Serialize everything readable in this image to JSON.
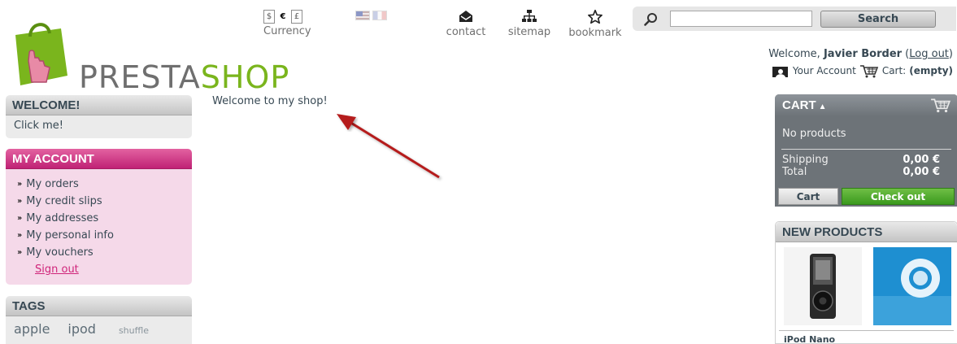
{
  "brand": {
    "logo_left": "PRESTA",
    "logo_right": "SHOP",
    "accent": "#7ab51d",
    "pink": "#c02275"
  },
  "header": {
    "currencies": [
      "$",
      "€",
      "£"
    ],
    "currency_selected": "€",
    "currency_label": "Currency",
    "languages": [
      "flag-us-icon",
      "flag-fr-icon"
    ],
    "permalinks": {
      "contact": "contact",
      "sitemap": "sitemap",
      "bookmark": "bookmark"
    },
    "search": {
      "value": "",
      "button": "Search"
    },
    "user": {
      "welcome": "Welcome,",
      "name": "Javier Border",
      "logout": "Log out",
      "your_account": "Your Account",
      "cart_label": "Cart:",
      "cart_state": "(empty)"
    }
  },
  "left": {
    "welcome": {
      "title": "WELCOME!",
      "body": "Click me!"
    },
    "account": {
      "title": "MY ACCOUNT",
      "items": [
        "My orders",
        "My credit slips",
        "My addresses",
        "My personal info",
        "My vouchers"
      ],
      "signout": "Sign out"
    },
    "tags": {
      "title": "TAGS",
      "items": [
        "apple",
        "ipod",
        "shuffle"
      ]
    }
  },
  "center": {
    "text": "Welcome to my shop!"
  },
  "right": {
    "cart": {
      "title": "CART",
      "empty": "No products",
      "shipping_label": "Shipping",
      "shipping_value": "0,00 €",
      "total_label": "Total",
      "total_value": "0,00 €",
      "cart_button": "Cart",
      "checkout_button": "Check out"
    },
    "new_products": {
      "title": "NEW PRODUCTS",
      "first_name": "iPod Nano"
    }
  }
}
